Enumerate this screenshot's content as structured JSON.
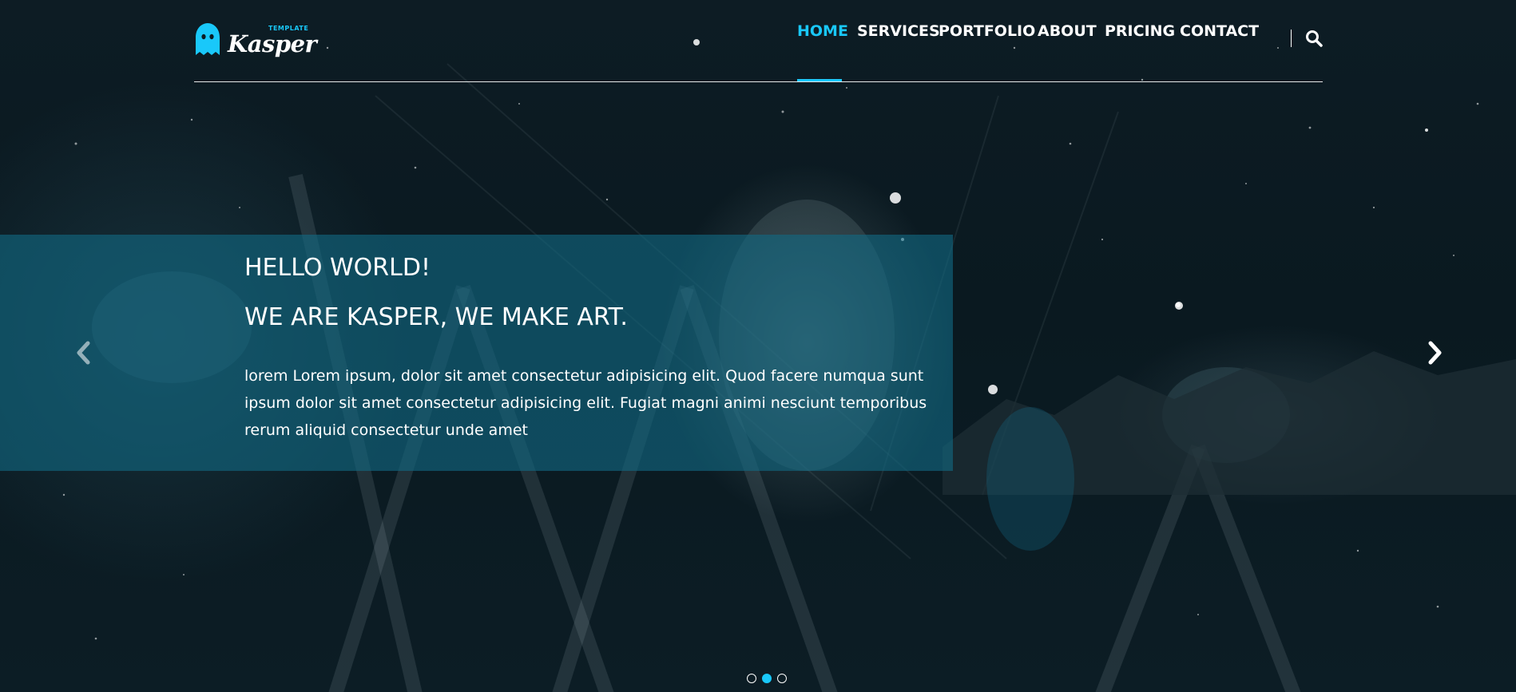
{
  "brand": {
    "name": "Kasper",
    "tag": "TEMPLATE",
    "accent": "#19c8fa"
  },
  "nav": {
    "items": [
      {
        "label": "HOME",
        "active": true
      },
      {
        "label": "SERVICES"
      },
      {
        "label": "PORTFOLIO"
      },
      {
        "label": "ABOUT"
      },
      {
        "label": "PRICING"
      },
      {
        "label": "CONTACT"
      }
    ],
    "search_icon": "search-icon"
  },
  "slide": {
    "title": "HELLO WORLD!",
    "subtitle": "WE ARE KASPER, WE MAKE ART.",
    "body": "lorem Lorem ipsum, dolor sit amet consectetur adipisicing elit. Quod facere numqua sunt ipsum dolor sit amet consectetur adipisicing elit. Fugiat magni animi nesciunt temporibus rerum aliquid consectetur unde amet",
    "prev_icon": "chevron-left-icon",
    "next_icon": "chevron-right-icon",
    "overlay_color": "#126982"
  },
  "slider": {
    "count": 3,
    "active": 2
  }
}
